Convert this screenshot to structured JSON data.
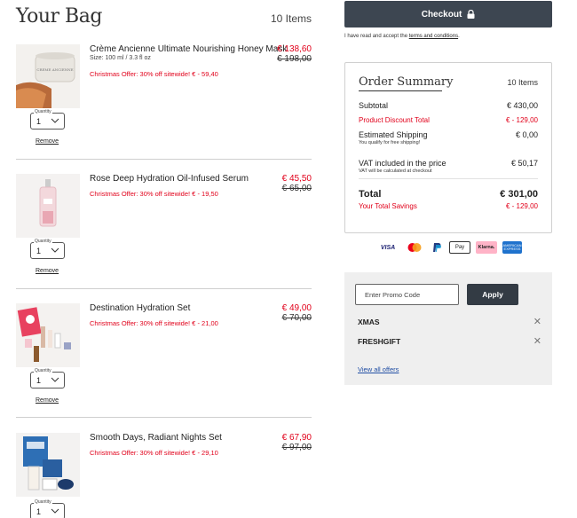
{
  "bag": {
    "title": "Your Bag",
    "count": "10 Items"
  },
  "qty_label": "Quantity",
  "remove_label": "Remove",
  "items": [
    {
      "name": "Crème Ancienne Ultimate Nourishing Honey Mask",
      "size": "Size: 100 ml / 3.3 fl oz",
      "offer": "Christmas Offer: 30% off sitewide! € - 59,40",
      "price": "€ 138,60",
      "was": "€ 198,00",
      "qty": "1"
    },
    {
      "name": "Rose Deep Hydration Oil-Infused Serum",
      "size": "",
      "offer": "Christmas Offer: 30% off sitewide! € - 19,50",
      "price": "€ 45,50",
      "was": "€ 65,00",
      "qty": "1"
    },
    {
      "name": "Destination Hydration Set",
      "size": "",
      "offer": "Christmas Offer: 30% off sitewide! € - 21,00",
      "price": "€ 49,00",
      "was": "€ 70,00",
      "qty": "1"
    },
    {
      "name": "Smooth Days, Radiant Nights Set",
      "size": "",
      "offer": "Christmas Offer: 30% off sitewide! € - 29,10",
      "price": "€ 67,90",
      "was": "€ 97,00",
      "qty": "1"
    }
  ],
  "checkout": {
    "label": "Checkout",
    "terms_prefix": "I have read and accept the ",
    "terms_link": "terms and conditions",
    "terms_suffix": "."
  },
  "summary": {
    "title": "Order Summary",
    "count": "10 Items",
    "subtotal_label": "Subtotal",
    "subtotal": "€ 430,00",
    "discount_label": "Product Discount Total",
    "discount": "€ - 129,00",
    "shipping_label": "Estimated Shipping",
    "shipping_note": "You qualify for free shipping!",
    "shipping": "€ 0,00",
    "vat_label": "VAT included in the price",
    "vat_note": "VAT will be calculated at checkout",
    "vat": "€ 50,17",
    "total_label": "Total",
    "total": "€ 301,00",
    "savings_label": "Your Total Savings",
    "savings": "€ - 129,00"
  },
  "payments": [
    "VISA",
    "Mastercard",
    "PayPal",
    "Apple Pay",
    "Klarna.",
    "American Express"
  ],
  "promo": {
    "placeholder": "Enter Promo Code",
    "apply": "Apply",
    "codes": [
      "XMAS",
      "FRESHGIFT"
    ],
    "view_all": "View all offers"
  },
  "colors": {
    "accent_red": "#e1001a",
    "button_dark": "#3d4651",
    "link_blue": "#1f4da3"
  }
}
